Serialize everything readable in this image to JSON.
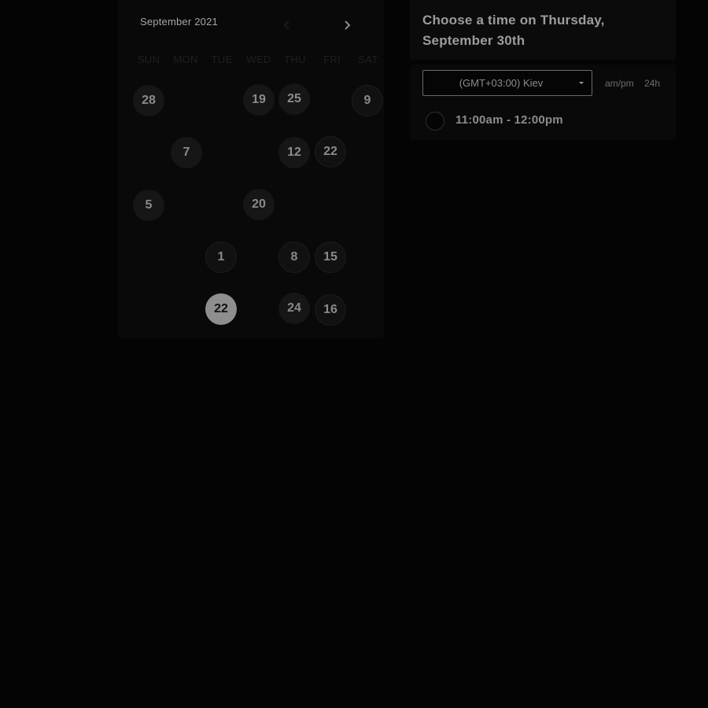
{
  "calendar": {
    "month_label": "September 2021",
    "prev_icon": "chevron-left-icon",
    "next_icon": "chevron-right-icon",
    "weekdays": [
      "SUN",
      "MON",
      "TUE",
      "WED",
      "THU",
      "FRI",
      "SAT"
    ],
    "weeks": [
      [
        "28",
        "",
        "",
        "19",
        "25",
        "",
        "9"
      ],
      [
        "",
        "7",
        "",
        "",
        "12",
        "22",
        ""
      ],
      [
        "5",
        "",
        "",
        "20",
        "",
        "",
        ""
      ],
      [
        "",
        "",
        "1",
        "",
        "8",
        "15",
        ""
      ],
      [
        "",
        "",
        "22",
        "",
        "24",
        "16",
        ""
      ]
    ],
    "selected_day": "22"
  },
  "time_panel": {
    "heading_line1": "Choose a time on Thursday,",
    "heading_line2": "September 30th",
    "timezone": "(GMT+03:00) Kiev",
    "format_ampm": "am/pm",
    "format_24h": "24h",
    "slots": [
      "11:00am - 12:00pm"
    ]
  },
  "colors": {
    "background": "#040404",
    "card": "#090909",
    "selected_day": "#8e8e8e"
  }
}
